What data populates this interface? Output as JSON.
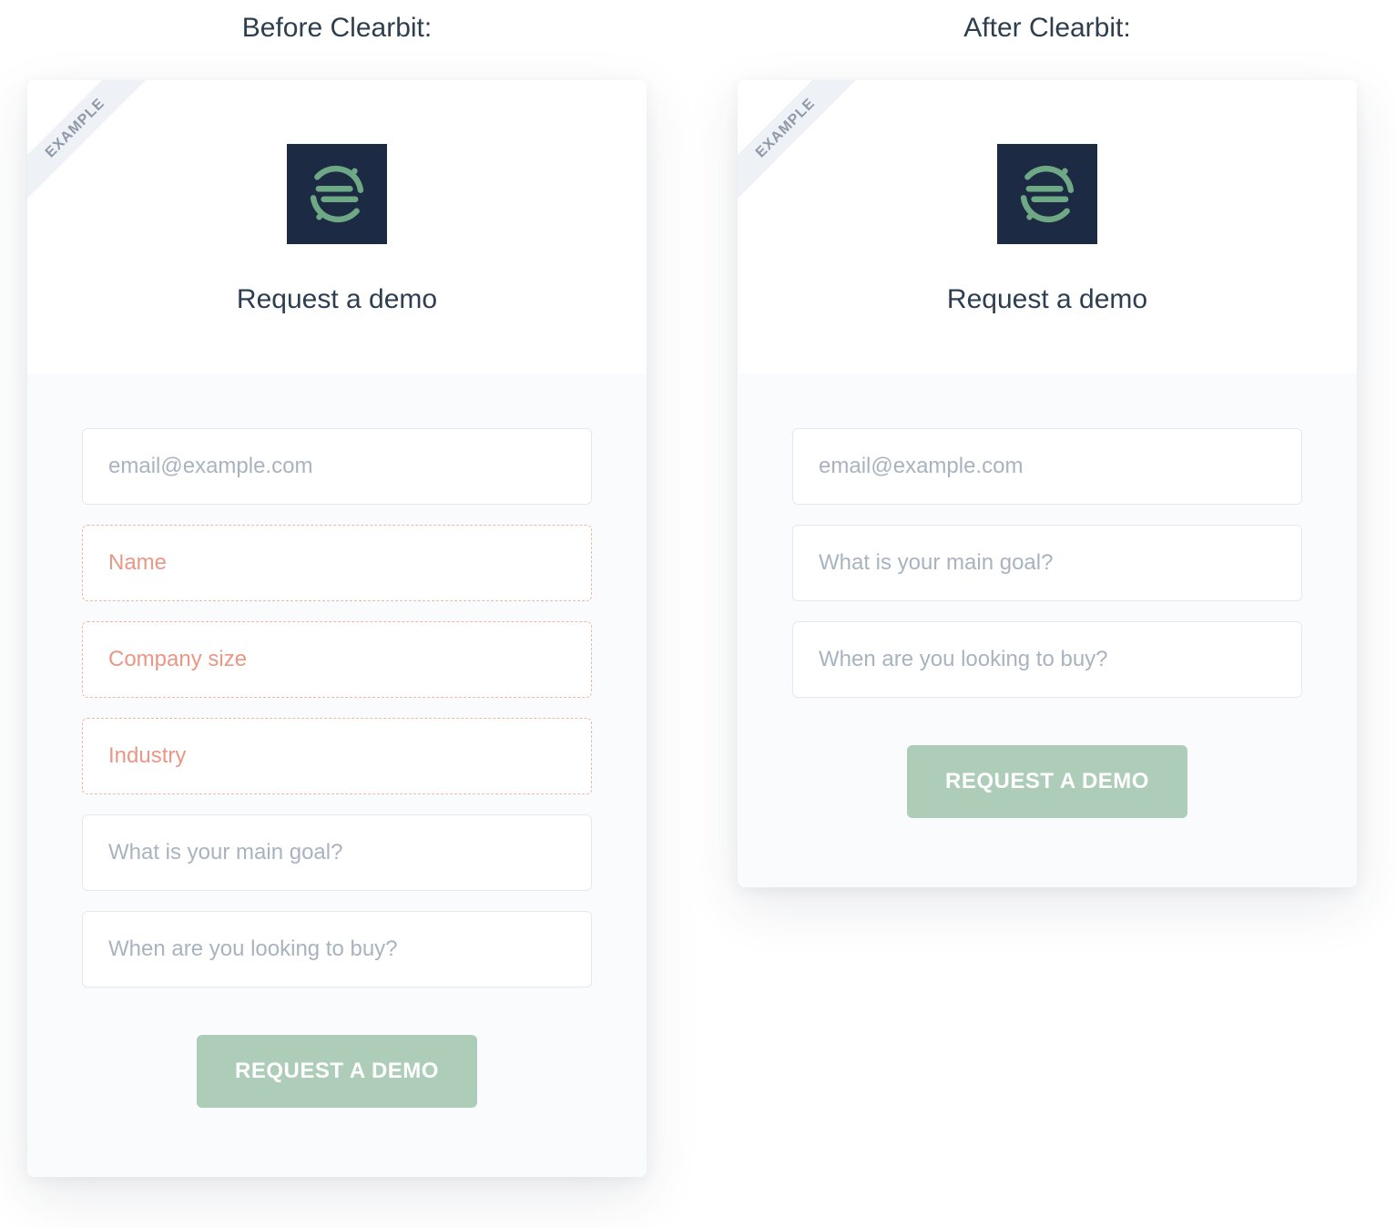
{
  "titles": {
    "before": "Before Clearbit:",
    "after": "After Clearbit:"
  },
  "ribbon_text": "EXAMPLE",
  "form_heading": "Request a demo",
  "submit_label": "REQUEST A DEMO",
  "logo_name": "segment-logo-icon",
  "colors": {
    "logo_bg": "#1d2a44",
    "logo_fg": "#6fa884",
    "removed_border": "#f3b5a5",
    "removed_text": "#e88c78",
    "button_bg": "#aecdb9"
  },
  "before_form": {
    "fields": [
      {
        "placeholder": "email@example.com",
        "removed": false
      },
      {
        "placeholder": "Name",
        "removed": true
      },
      {
        "placeholder": "Company size",
        "removed": true
      },
      {
        "placeholder": "Industry",
        "removed": true
      },
      {
        "placeholder": "What is your main goal?",
        "removed": false
      },
      {
        "placeholder": "When are you looking to buy?",
        "removed": false
      }
    ]
  },
  "after_form": {
    "fields": [
      {
        "placeholder": "email@example.com",
        "removed": false
      },
      {
        "placeholder": "What is your main goal?",
        "removed": false
      },
      {
        "placeholder": "When are you looking to buy?",
        "removed": false
      }
    ]
  }
}
